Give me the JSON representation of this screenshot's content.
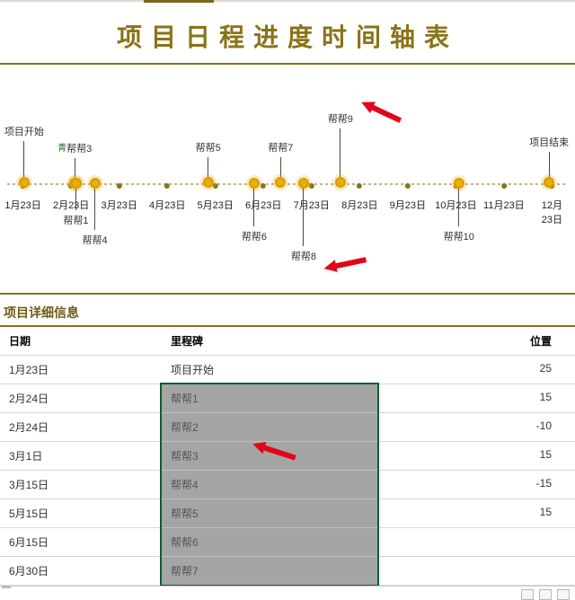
{
  "title": "项目日程进度时间轴表",
  "section_title": "项目详细信息",
  "columns": {
    "date": "日期",
    "milestone": "里程碑",
    "position": "位置"
  },
  "axis_ticks": [
    "1月23日",
    "2月23日",
    "3月23日",
    "4月23日",
    "5月23日",
    "6月23日",
    "7月23日",
    "8月23日",
    "9月23日",
    "10月23日",
    "11月23日",
    "12月23日"
  ],
  "milestones": [
    {
      "label": "项目开始",
      "x": 4.2,
      "dir": "up",
      "stem": 48
    },
    {
      "label": "帮帮3",
      "x": 13.0,
      "dir": "up",
      "stem": 30,
      "prefix": "青"
    },
    {
      "label": "帮帮1",
      "x": 13.2,
      "dir": "down",
      "stem": 32
    },
    {
      "label": "帮帮4",
      "x": 16.5,
      "dir": "down",
      "stem": 54
    },
    {
      "label": "帮帮5",
      "x": 36.2,
      "dir": "up",
      "stem": 30
    },
    {
      "label": "帮帮6",
      "x": 44.2,
      "dir": "down",
      "stem": 50
    },
    {
      "label": "帮帮7",
      "x": 48.8,
      "dir": "up",
      "stem": 30
    },
    {
      "label": "帮帮8",
      "x": 52.8,
      "dir": "down",
      "stem": 72
    },
    {
      "label": "帮帮9",
      "x": 59.2,
      "dir": "up",
      "stem": 62
    },
    {
      "label": "帮帮10",
      "x": 79.8,
      "dir": "down",
      "stem": 50
    },
    {
      "label": "项目结束",
      "x": 95.5,
      "dir": "up",
      "stem": 36
    }
  ],
  "rows": [
    {
      "date": "1月23日",
      "milestone": "项目开始",
      "position": "25",
      "sel": false
    },
    {
      "date": "2月24日",
      "milestone": "帮帮1",
      "position": "15",
      "sel": true
    },
    {
      "date": "2月24日",
      "milestone": "帮帮2",
      "position": "-10",
      "sel": true
    },
    {
      "date": "3月1日",
      "milestone": "帮帮3",
      "position": "15",
      "sel": true
    },
    {
      "date": "3月15日",
      "milestone": "帮帮4",
      "position": "-15",
      "sel": true
    },
    {
      "date": "5月15日",
      "milestone": "帮帮5",
      "position": "15",
      "sel": true
    },
    {
      "date": "6月15日",
      "milestone": "帮帮6",
      "position": "",
      "sel": true
    },
    {
      "date": "6月30日",
      "milestone": "帮帮7",
      "position": "",
      "sel": true
    }
  ],
  "colors": {
    "accent": "#8a7318",
    "node": "#f2a900",
    "box": "#0b5e2f"
  }
}
